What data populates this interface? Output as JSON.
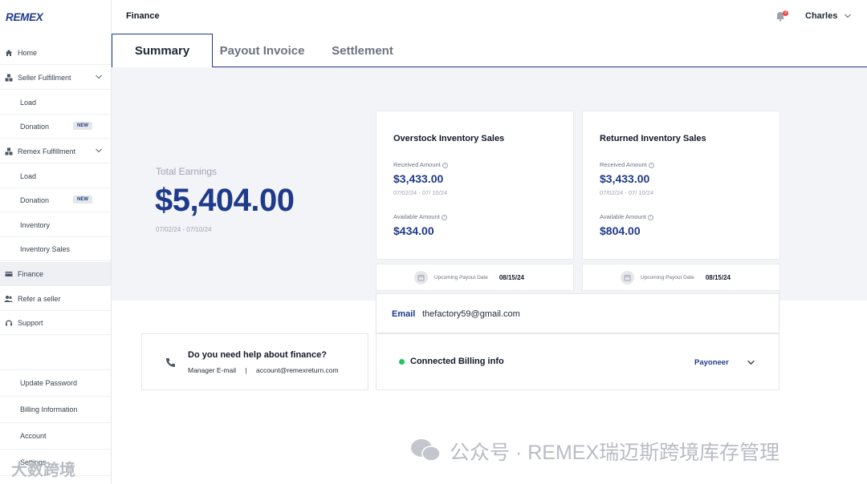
{
  "brand": {
    "logo": "REMEX"
  },
  "sidebar": {
    "items": [
      {
        "label": "Home"
      },
      {
        "label": "Seller Fulfillment"
      },
      {
        "label": "Load"
      },
      {
        "label": "Donation",
        "badge": "NEW"
      },
      {
        "label": "Remex Fulfillment"
      },
      {
        "label": "Load"
      },
      {
        "label": "Donation",
        "badge": "NEW"
      },
      {
        "label": "Inventory"
      },
      {
        "label": "Inventory Sales"
      },
      {
        "label": "Finance"
      },
      {
        "label": "Refer a seller"
      },
      {
        "label": "Support"
      }
    ],
    "bottom": [
      {
        "label": "Update Password"
      },
      {
        "label": "Billing Information"
      },
      {
        "label": "Account"
      },
      {
        "label": "Settings"
      }
    ]
  },
  "header": {
    "title": "Finance",
    "notification_count": "3",
    "user": "Charles"
  },
  "tabs": [
    {
      "label": "Summary"
    },
    {
      "label": "Payout Invoice"
    },
    {
      "label": "Settlement"
    }
  ],
  "summary": {
    "total_label": "Total Earnings",
    "total_value": "$5,404.00",
    "total_range": "07/02/24 - 07/10/24"
  },
  "cards": [
    {
      "title": "Overstock Inventory Sales",
      "received_label": "Received Amount",
      "received_value": "$3,433.00",
      "received_range": "07/02/24 - 07/ 10/24",
      "available_label": "Available Amount",
      "available_value": "$434.00",
      "payout_label": "Upcoming Payout Date",
      "payout_date": "08/15/24"
    },
    {
      "title": "Returned Inventory Sales",
      "received_label": "Received Amount",
      "received_value": "$3,433.00",
      "received_range": "07/02/24 - 07/ 10/24",
      "available_label": "Available Amount",
      "available_value": "$804.00",
      "payout_label": "Upcoming Payout Date",
      "payout_date": "08/15/24"
    }
  ],
  "email": {
    "label": "Email",
    "value": "thefactory59@gmail.com"
  },
  "billing": {
    "label": "Connected Billing info",
    "provider": "Payoneer"
  },
  "help": {
    "title": "Do you need help about finance?",
    "manager_label": "Manager E-mail",
    "separator": "|",
    "manager_email": "account@remexreturn.com"
  },
  "watermark": {
    "text": "公众号 · REMEX瑞迈斯跨境库存管理",
    "corner": "大数跨境"
  },
  "colors": {
    "brand": "#1e3a8a",
    "status_ok": "#22c55e",
    "alert": "#ef4444"
  }
}
